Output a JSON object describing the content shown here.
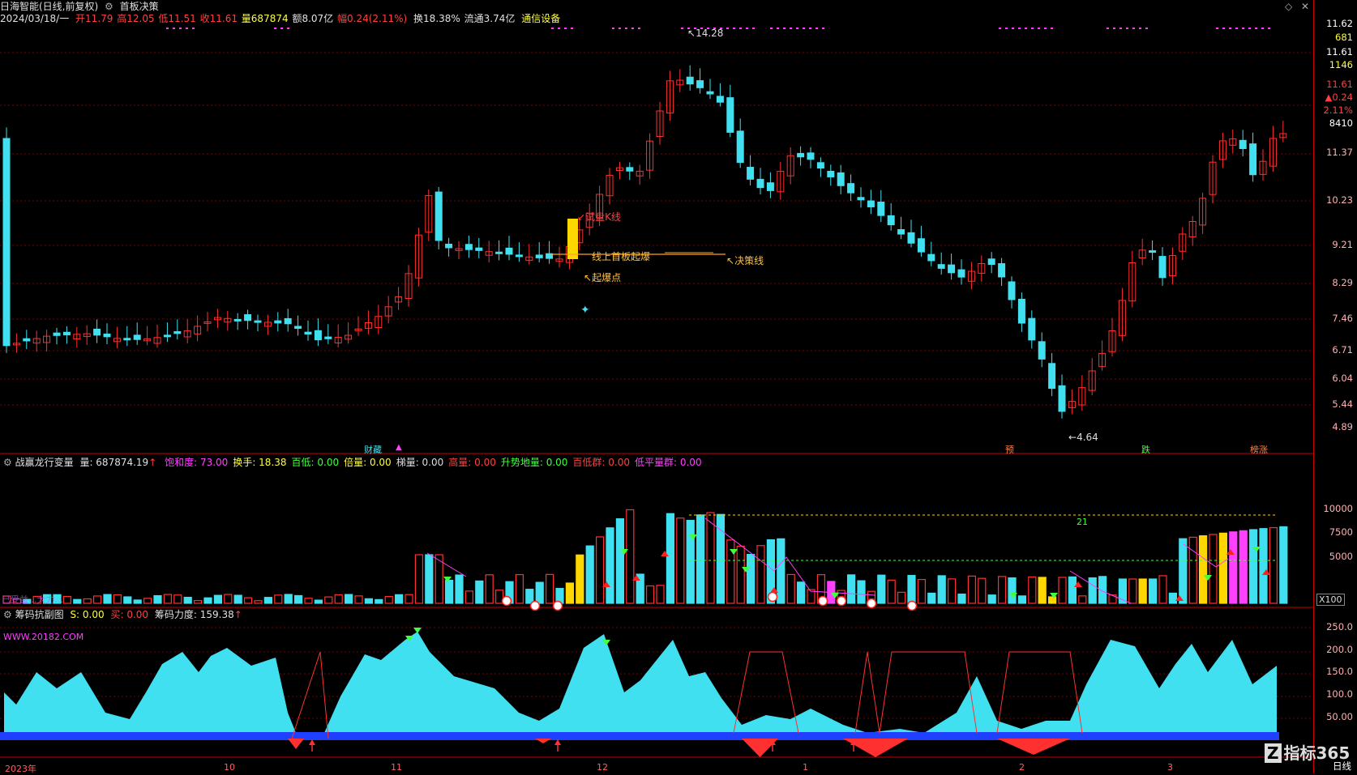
{
  "header": {
    "stock": "日海智能(日线,前复权)",
    "formula": "首板决策",
    "date": "2024/03/18/一",
    "open": "开11.79",
    "high": "高12.05",
    "low": "低11.51",
    "close": "收11.61",
    "volume": "量687874",
    "amount": "额8.07亿",
    "change": "幅0.24(2.11%)",
    "turnover": "换18.38%",
    "float": "流通3.74亿",
    "sector": "通信设备"
  },
  "price_axis": {
    "labels": [
      "11.62",
      "681",
      "11.61",
      "1146",
      "11.61",
      "▲0.24",
      "2.11%",
      "8410",
      "11.37",
      "10.23",
      "9.21",
      "8.29",
      "7.46",
      "6.71",
      "6.04",
      "5.44",
      "4.89"
    ]
  },
  "annotations": {
    "high_mark": "14.28",
    "low_mark": "4.64",
    "trial_k": "试盘K线",
    "first_board": "线上首板起爆",
    "decision_line": "决策线",
    "ignition": "起爆点",
    "tag_caizang": "财藏",
    "tag_yu": "预",
    "tag_die": "跌",
    "tag_bangzhang": "榜涨"
  },
  "panel2": {
    "title": "战赢龙行变量",
    "vol": "量: 687874.19",
    "items": [
      {
        "t": "饱和度: 73.00",
        "c": "#ff40ff"
      },
      {
        "t": "换手: 18.38",
        "c": "#ffff40"
      },
      {
        "t": "百低: 0.00",
        "c": "#40ff40"
      },
      {
        "t": "倍量: 0.00",
        "c": "#ffff40"
      },
      {
        "t": "梯量: 0.00",
        "c": "#dddddd"
      },
      {
        "t": "高量: 0.00",
        "c": "#ff4040"
      },
      {
        "t": "升势地量: 0.00",
        "c": "#40ff40"
      },
      {
        "t": "百低群: 0.00",
        "c": "#ff4040"
      },
      {
        "t": "低平量群: 0.00",
        "c": "#ff40ff"
      }
    ],
    "axis": [
      "10000",
      "7500",
      "5000"
    ],
    "unit": "X100",
    "label_21": "21",
    "watermark": "已受益...大力..."
  },
  "panel3": {
    "title": "筹码抗副图",
    "s": "S: 0.00",
    "buy": "买: 0.00",
    "force": "筹码力度: 159.38",
    "site": "WWW.20182.COM",
    "axis": [
      "250.0",
      "200.0",
      "150.0",
      "100.0",
      "50.00"
    ]
  },
  "date_axis": {
    "labels": [
      "2023年",
      "10",
      "11",
      "12",
      "1",
      "2",
      "3"
    ],
    "period": "日线"
  },
  "logo": "指标365",
  "colors": {
    "up": "#ff3030",
    "down": "#40e0f0",
    "bg": "#000000",
    "grid": "#800000"
  }
}
